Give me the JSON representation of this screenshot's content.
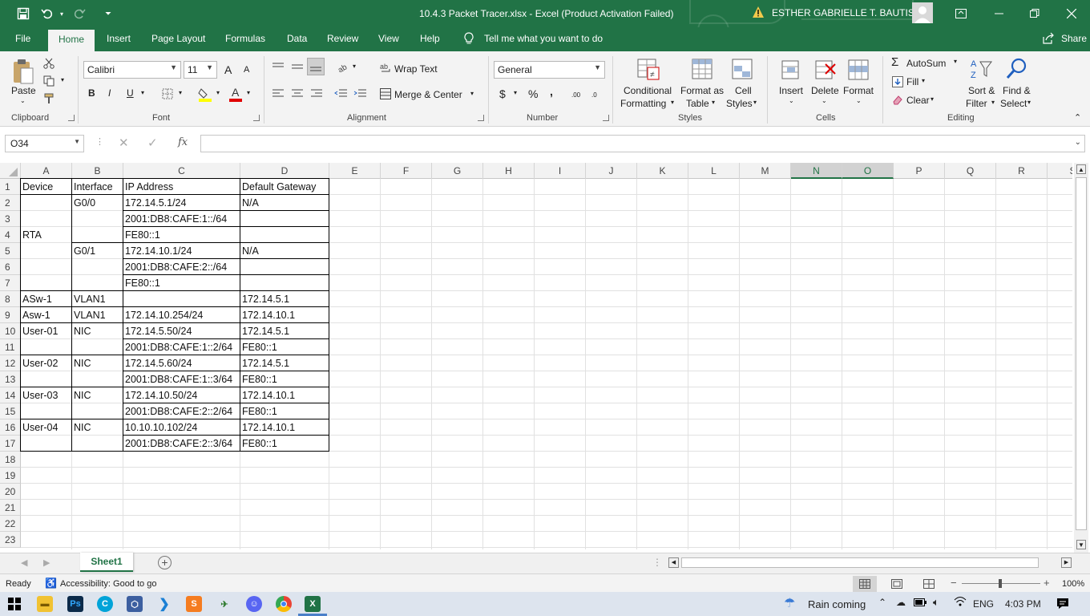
{
  "titlebar": {
    "doc_title": "10.4.3 Packet Tracer.xlsx  -  Excel (Product Activation Failed)",
    "user_name": "ESTHER GABRIELLE T. BAUTISTA"
  },
  "tabs": [
    "File",
    "Home",
    "Insert",
    "Page Layout",
    "Formulas",
    "Data",
    "Review",
    "View",
    "Help"
  ],
  "tell_me": "Tell me what you want to do",
  "share": "Share",
  "ribbon": {
    "clipboard": {
      "paste": "Paste",
      "label": "Clipboard"
    },
    "font": {
      "name": "Calibri",
      "size": "11",
      "label": "Font",
      "bold": "B",
      "italic": "I",
      "underline": "U",
      "grow": "A",
      "shrink": "A"
    },
    "alignment": {
      "wrap": "Wrap Text",
      "merge": "Merge & Center",
      "label": "Alignment"
    },
    "number": {
      "format": "General",
      "currency": "$",
      "percent": "%",
      "comma": ",",
      "inc_dec": ".00",
      "dec_dec": ".0",
      "label": "Number"
    },
    "styles": {
      "conditional": "Conditional",
      "conditional2": "Formatting",
      "format_table": "Format as",
      "format_table2": "Table",
      "cell_styles": "Cell",
      "cell_styles2": "Styles",
      "label": "Styles"
    },
    "cells": {
      "insert": "Insert",
      "delete": "Delete",
      "format": "Format",
      "label": "Cells"
    },
    "editing": {
      "autosum": "AutoSum",
      "fill": "Fill",
      "clear": "Clear",
      "sort": "Sort &",
      "sort2": "Filter",
      "find": "Find &",
      "find2": "Select",
      "label": "Editing"
    }
  },
  "formula_bar": {
    "name_box": "O34",
    "fx": "fx",
    "value": ""
  },
  "columns": [
    "A",
    "B",
    "C",
    "D",
    "E",
    "F",
    "G",
    "H",
    "I",
    "J",
    "K",
    "L",
    "M",
    "N",
    "O",
    "P",
    "Q",
    "R",
    "S"
  ],
  "rows": [
    "1",
    "2",
    "3",
    "4",
    "5",
    "6",
    "7",
    "8",
    "9",
    "10",
    "11",
    "12",
    "13",
    "14",
    "15",
    "16",
    "17",
    "18",
    "19",
    "20",
    "21",
    "22",
    "23"
  ],
  "table": {
    "headers": [
      "Device",
      "Interface",
      "IP Address",
      "Default Gateway"
    ],
    "rows": [
      [
        "",
        "G0/0",
        "172.14.5.1/24",
        "N/A"
      ],
      [
        "",
        "",
        "2001:DB8:CAFE:1::/64",
        ""
      ],
      [
        "RTA",
        "",
        "FE80::1",
        ""
      ],
      [
        "",
        "G0/1",
        "172.14.10.1/24",
        "N/A"
      ],
      [
        "",
        "",
        "2001:DB8:CAFE:2::/64",
        ""
      ],
      [
        "",
        "",
        "FE80::1",
        ""
      ],
      [
        "ASw-1",
        "VLAN1",
        "",
        "172.14.5.1"
      ],
      [
        "Asw-1",
        "VLAN1",
        "172.14.10.254/24",
        "172.14.10.1"
      ],
      [
        "User-01",
        "NIC",
        "172.14.5.50/24",
        "172.14.5.1"
      ],
      [
        "",
        "",
        "2001:DB8:CAFE:1::2/64",
        "FE80::1"
      ],
      [
        "User-02",
        "NIC",
        "172.14.5.60/24",
        "172.14.5.1"
      ],
      [
        "",
        "",
        "2001:DB8:CAFE:1::3/64",
        "FE80::1"
      ],
      [
        "User-03",
        "NIC",
        "172.14.10.50/24",
        "172.14.10.1"
      ],
      [
        "",
        "",
        "2001:DB8:CAFE:2::2/64",
        "FE80::1"
      ],
      [
        "User-04",
        "NIC",
        "10.10.10.102/24",
        "172.14.10.1"
      ],
      [
        "",
        "",
        "2001:DB8:CAFE:2::3/64",
        "FE80::1"
      ]
    ]
  },
  "sheet_tab": "Sheet1",
  "status": {
    "ready": "Ready",
    "accessibility": "Accessibility: Good to go",
    "zoom": "100%"
  },
  "taskbar": {
    "weather": "Rain coming",
    "lang": "ENG",
    "time": "4:03 PM"
  }
}
